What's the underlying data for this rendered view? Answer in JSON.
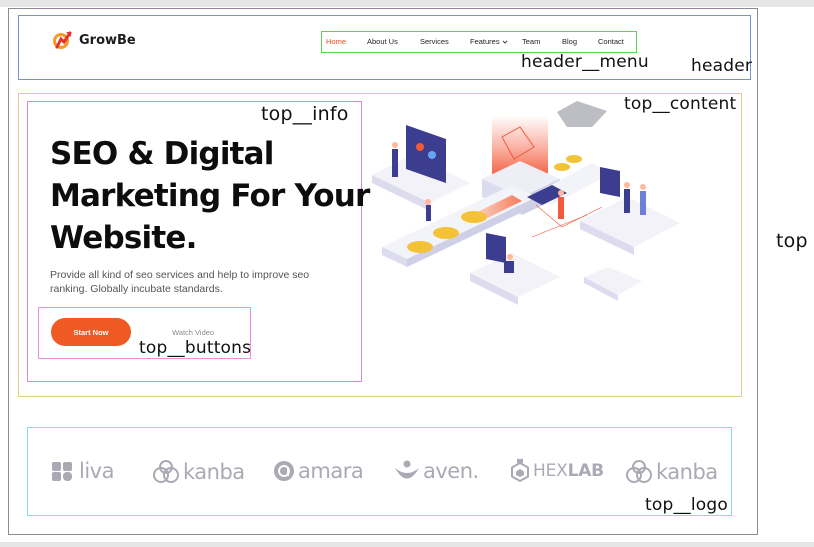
{
  "site": {
    "brand_name": "GrowBe",
    "brand_color": "#ef4b23"
  },
  "menu": {
    "items": [
      {
        "label": "Home",
        "active": true
      },
      {
        "label": "About Us",
        "active": false
      },
      {
        "label": "Services",
        "active": false
      },
      {
        "label": "Features",
        "active": false,
        "dropdown": true
      },
      {
        "label": "Team",
        "active": false
      },
      {
        "label": "Blog",
        "active": false
      },
      {
        "label": "Contact",
        "active": false
      }
    ]
  },
  "hero": {
    "title_lines": [
      "SEO & Digital",
      "Marketing For Your",
      "Website."
    ],
    "description": "Provide all kind of seo services and help to improve seo ranking. Globally incubate standards.",
    "start_label": "Start Now",
    "watch_label": "Watch Video",
    "accent_color": "#ef5a24"
  },
  "partners": {
    "logos": [
      {
        "name": "liva",
        "icon": "liva-logo-icon"
      },
      {
        "name": "kanba",
        "icon": "kanba-logo-icon"
      },
      {
        "name": "amara",
        "icon": "amara-logo-icon"
      },
      {
        "name": "aven.",
        "icon": "aven-logo-icon"
      },
      {
        "name_regular": "HEX",
        "name_bold": "LAB",
        "icon": "hexlab-logo-icon"
      },
      {
        "name": "kanba",
        "icon": "kanba-logo-icon"
      }
    ]
  },
  "annotations": {
    "header": "header",
    "header_menu": "header__menu",
    "top_content": "top__content",
    "top_info": "top__info",
    "top_buttons": "top__buttons",
    "top_logo": "top__logo",
    "top": "top"
  }
}
